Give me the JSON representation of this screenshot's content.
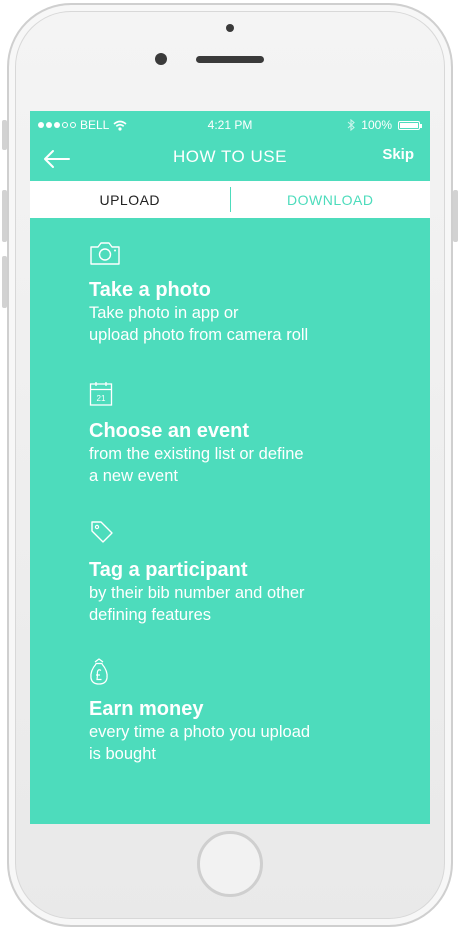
{
  "status_bar": {
    "carrier": "BELL",
    "time": "4:21 PM",
    "battery": "100%",
    "signal_icon": "signal-dots-icon",
    "wifi_icon": "wifi-icon",
    "bluetooth_icon": "bluetooth-icon"
  },
  "navbar": {
    "title": "HOW TO USE",
    "skip_label": "Skip",
    "back_icon": "back-arrow-icon"
  },
  "tabs": [
    {
      "label": "UPLOAD",
      "active": true
    },
    {
      "label": "DOWNLOAD",
      "active": false
    }
  ],
  "steps": [
    {
      "icon": "camera-icon",
      "title": "Take a photo",
      "desc_line1": "Take photo in app or",
      "desc_line2": "upload photo from camera roll"
    },
    {
      "icon": "calendar-icon",
      "calendar_day": "21",
      "title": "Choose an event",
      "desc_line1": "from the existing list or define",
      "desc_line2": "a new event"
    },
    {
      "icon": "tag-icon",
      "title": "Tag a participant",
      "desc_line1": "by their bib number and other",
      "desc_line2": "defining features"
    },
    {
      "icon": "money-bag-icon",
      "title": "Earn money",
      "desc_line1": "every time a photo you upload",
      "desc_line2": "is bought"
    }
  ],
  "colors": {
    "accent": "#4ddcbc",
    "tab_active_text": "#222222"
  }
}
